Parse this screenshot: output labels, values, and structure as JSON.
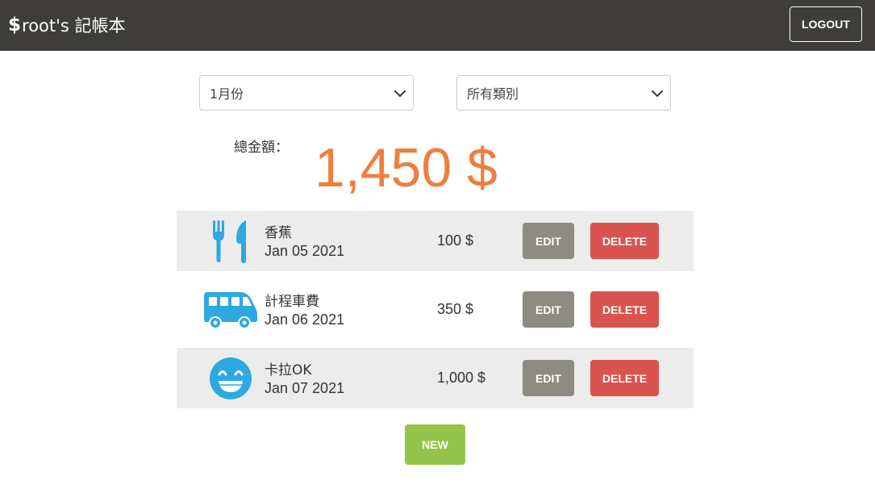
{
  "header": {
    "brand_symbol": "$",
    "brand_text": "root's 記帳本",
    "logout_label": "LOGOUT"
  },
  "filters": {
    "month": {
      "selected": "1月份"
    },
    "category": {
      "selected": "所有類別"
    }
  },
  "summary": {
    "total_label": "總金額：",
    "total_amount": "1,450 $"
  },
  "records": [
    {
      "icon": "utensils-icon",
      "name": "香蕉",
      "date": "Jan 05 2021",
      "amount": "100 $"
    },
    {
      "icon": "bus-icon",
      "name": "計程車費",
      "date": "Jan 06 2021",
      "amount": "350 $"
    },
    {
      "icon": "grin-icon",
      "name": "卡拉OK",
      "date": "Jan 07 2021",
      "amount": "1,000 $"
    }
  ],
  "actions": {
    "edit_label": "EDIT",
    "delete_label": "DELETE",
    "new_label": "NEW"
  },
  "colors": {
    "navbar": "#3e3d39",
    "total": "#f07d3e",
    "icon": "#2ea8e0",
    "edit": "#8e8b83",
    "delete": "#d9534f",
    "new": "#93c54b"
  }
}
